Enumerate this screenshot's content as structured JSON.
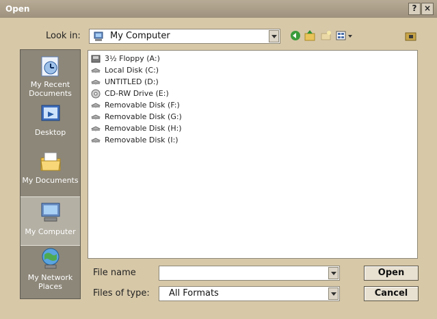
{
  "window": {
    "title": "Open",
    "help_label": "?",
    "close_label": "×"
  },
  "look_in": {
    "label": "Look in:",
    "value": "My Computer"
  },
  "toolbar": {
    "icons": [
      "back-icon",
      "up-folder-icon",
      "new-folder-icon",
      "views-menu-icon",
      "tools-icon"
    ]
  },
  "places": [
    {
      "label": "My Recent Documents",
      "icon": "recent-documents-icon"
    },
    {
      "label": "Desktop",
      "icon": "desktop-icon"
    },
    {
      "label": "My Documents",
      "icon": "my-documents-icon"
    },
    {
      "label": "My Computer",
      "icon": "my-computer-icon",
      "selected": true
    },
    {
      "label": "My Network Places",
      "icon": "network-places-icon"
    }
  ],
  "files": [
    {
      "name": "3½ Floppy (A:)",
      "icon": "floppy-drive-icon"
    },
    {
      "name": "Local Disk (C:)",
      "icon": "hard-disk-icon"
    },
    {
      "name": "UNTITLED (D:)",
      "icon": "hard-disk-icon"
    },
    {
      "name": "CD-RW Drive (E:)",
      "icon": "cd-drive-icon"
    },
    {
      "name": "Removable Disk (F:)",
      "icon": "removable-disk-icon"
    },
    {
      "name": "Removable Disk (G:)",
      "icon": "removable-disk-icon"
    },
    {
      "name": "Removable Disk (H:)",
      "icon": "removable-disk-icon"
    },
    {
      "name": "Removable Disk (I:)",
      "icon": "removable-disk-icon"
    }
  ],
  "file_name": {
    "label": "File name",
    "value": ""
  },
  "file_type": {
    "label": "Files of type:",
    "value": "All Formats"
  },
  "buttons": {
    "open": "Open",
    "cancel": "Cancel"
  },
  "colors": {
    "dialog_bg": "#d7c8a8",
    "places_bg": "#8d8779",
    "titlebar": "#a89c88"
  }
}
